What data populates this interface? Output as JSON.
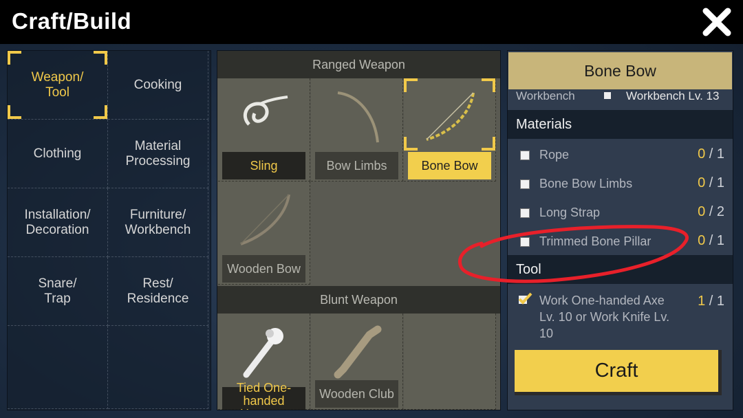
{
  "window": {
    "title": "Craft/Build",
    "close_icon": "close-x-icon"
  },
  "categories": [
    {
      "label": "Weapon/\nTool",
      "active": true
    },
    {
      "label": "Cooking"
    },
    {
      "label": "Clothing"
    },
    {
      "label": "Material\nProcessing"
    },
    {
      "label": "Installation/\nDecoration"
    },
    {
      "label": "Furniture/\nWorkbench"
    },
    {
      "label": "Snare/\nTrap"
    },
    {
      "label": "Rest/\nResidence"
    }
  ],
  "sections": [
    {
      "title": "Ranged Weapon",
      "items": [
        {
          "label": "Sling",
          "icon": "sling-icon",
          "style": "gold"
        },
        {
          "label": "Bow Limbs",
          "icon": "bow-limbs-icon"
        },
        {
          "label": "Bone Bow",
          "icon": "bone-bow-icon",
          "style": "selected"
        },
        {
          "label": "Wooden Bow",
          "icon": "wooden-bow-icon"
        }
      ]
    },
    {
      "title": "Blunt Weapon",
      "items": [
        {
          "label": "Tied One-handed Hammer",
          "icon": "hammer-icon",
          "style": "gold"
        },
        {
          "label": "Wooden Club",
          "icon": "club-icon"
        }
      ]
    }
  ],
  "detail": {
    "title": "Bone Bow",
    "workbench_label": "Workbench",
    "workbench_value": "Workbench Lv. 13",
    "materials_heading": "Materials",
    "materials": [
      {
        "name": "Rope",
        "have": "0",
        "need": "1"
      },
      {
        "name": "Bone Bow Limbs",
        "have": "0",
        "need": "1"
      },
      {
        "name": "Long Strap",
        "have": "0",
        "need": "2"
      },
      {
        "name": "Trimmed Bone Pillar",
        "have": "0",
        "need": "1"
      }
    ],
    "tool_heading": "Tool",
    "tool": {
      "name": "Work One-handed Axe Lv. 10 or Work Knife Lv. 10",
      "have": "1",
      "need": "1"
    },
    "craft_label": "Craft"
  },
  "colors": {
    "accent": "#f1c94a",
    "annotation": "#e8202a"
  }
}
